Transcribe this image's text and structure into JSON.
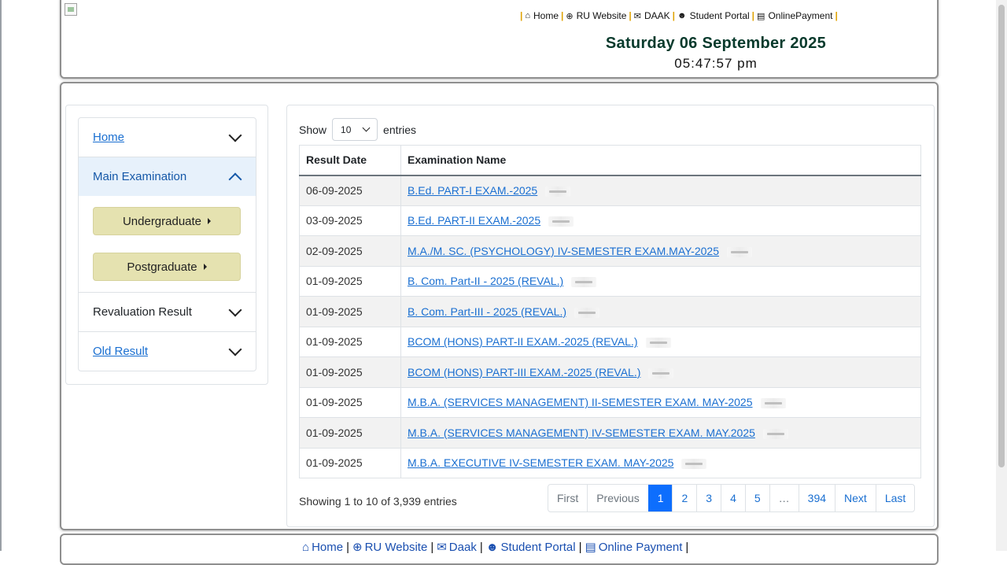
{
  "header": {
    "nav": [
      {
        "label": "Home",
        "icon": "home-icon",
        "glyph": "⌂"
      },
      {
        "label": "RU Website",
        "icon": "globe-icon",
        "glyph": "⊕"
      },
      {
        "label": "DAAK",
        "icon": "envelope-icon",
        "glyph": "✉"
      },
      {
        "label": "Student Portal",
        "icon": "graduate-icon",
        "glyph": "☻"
      },
      {
        "label": "OnlinePayment",
        "icon": "credit-card-icon",
        "glyph": "▤"
      }
    ],
    "date": "Saturday 06 September 2025",
    "time": "05:47:57 pm"
  },
  "sidebar": {
    "home": "Home",
    "main_examination": "Main Examination",
    "undergraduate": "Undergraduate",
    "postgraduate": "Postgraduate",
    "revaluation_result": "Revaluation Result",
    "old_result": "Old Result"
  },
  "table": {
    "show_label": "Show",
    "entries_label": "entries",
    "page_length": "10",
    "headers": {
      "date": "Result Date",
      "name": "Examination Name"
    },
    "rows": [
      {
        "date": "06-09-2025",
        "name": "B.Ed. PART-I EXAM.-2025"
      },
      {
        "date": "03-09-2025",
        "name": "B.Ed. PART-II EXAM.-2025"
      },
      {
        "date": "02-09-2025",
        "name": "M.A./M. SC. (PSYCHOLOGY) IV-SEMESTER EXAM.MAY-2025"
      },
      {
        "date": "01-09-2025",
        "name": "B. Com. Part-II - 2025 (REVAL.)"
      },
      {
        "date": "01-09-2025",
        "name": "B. Com. Part-III - 2025 (REVAL.)"
      },
      {
        "date": "01-09-2025",
        "name": "BCOM (HONS) PART-II EXAM.-2025 (REVAL.)"
      },
      {
        "date": "01-09-2025",
        "name": "BCOM (HONS) PART-III EXAM.-2025 (REVAL.)"
      },
      {
        "date": "01-09-2025",
        "name": "M.B.A. (SERVICES MANAGEMENT) II-SEMESTER EXAM. MAY-2025"
      },
      {
        "date": "01-09-2025",
        "name": "M.B.A. (SERVICES MANAGEMENT) IV-SEMESTER EXAM. MAY.2025"
      },
      {
        "date": "01-09-2025",
        "name": "M.B.A. EXECUTIVE IV-SEMESTER EXAM. MAY-2025"
      }
    ],
    "info": "Showing 1 to 10 of 3,939 entries",
    "pagination": {
      "first": "First",
      "previous": "Previous",
      "pages": [
        "1",
        "2",
        "3",
        "4",
        "5",
        "…",
        "394"
      ],
      "active": "1",
      "next": "Next",
      "last": "Last"
    }
  },
  "footer": {
    "nav": [
      {
        "label": "Home",
        "icon": "home-icon",
        "glyph": "⌂"
      },
      {
        "label": "RU Website",
        "icon": "globe-icon",
        "glyph": "⊕"
      },
      {
        "label": "Daak",
        "icon": "envelope-icon",
        "glyph": "✉"
      },
      {
        "label": "Student Portal",
        "icon": "graduate-icon",
        "glyph": "☻"
      },
      {
        "label": "Online Payment",
        "icon": "credit-card-icon",
        "glyph": "▤"
      }
    ]
  },
  "colors": {
    "link": "#1a6fd1",
    "date_heading": "#083a2c",
    "category_button": "#e5e2b0",
    "active_page": "#0d6efd",
    "accordion_active": "#e7f1fb"
  }
}
